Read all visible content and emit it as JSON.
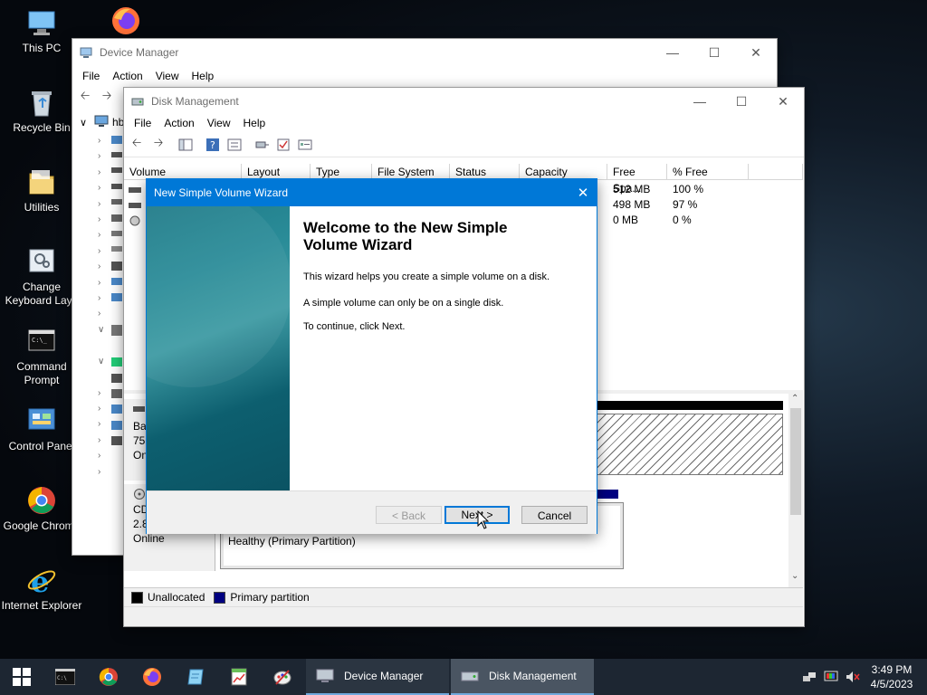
{
  "desktop": {
    "icons": [
      {
        "label": "This PC"
      },
      {
        "label": ""
      },
      {
        "label": "Recycle Bin"
      },
      {
        "label": "Utilities"
      },
      {
        "label": "Change Keyboard Layo"
      },
      {
        "label": "Command Prompt"
      },
      {
        "label": "Control Panel"
      },
      {
        "label": "Google Chrome"
      },
      {
        "label": "Internet Explorer"
      }
    ]
  },
  "device_manager": {
    "title": "Device Manager",
    "menu": [
      "File",
      "Action",
      "View",
      "Help"
    ],
    "tree_root": "hb"
  },
  "disk_management": {
    "title": "Disk Management",
    "menu": [
      "File",
      "Action",
      "View",
      "Help"
    ],
    "columns": [
      "Volume",
      "Layout",
      "Type",
      "File System",
      "Status",
      "Capacity",
      "Free Spa...",
      "% Free"
    ],
    "rows": [
      {
        "free": "512 MB",
        "pct": "100 %"
      },
      {
        "free": "498 MB",
        "pct": "97 %"
      },
      {
        "free": "0 MB",
        "pct": "0 %"
      }
    ],
    "disk0": {
      "line1": "Ba",
      "line2": "75.",
      "line3": "On"
    },
    "cdrom": {
      "line1": "CD",
      "line2": "2.8",
      "line3": "Online",
      "partition_status": "Healthy (Primary Partition)"
    },
    "legend": {
      "unallocated": "Unallocated",
      "primary": "Primary partition",
      "unallocated_color": "#000000",
      "primary_color": "#000080"
    }
  },
  "wizard": {
    "title": "New Simple Volume Wizard",
    "heading": "Welcome to the New Simple Volume Wizard",
    "p1": "This wizard helps you create a simple volume on a disk.",
    "p2": "A simple volume can only be on a single disk.",
    "p3": "To continue, click Next.",
    "back": "< Back",
    "next": "Next >",
    "cancel": "Cancel"
  },
  "taskbar": {
    "tasks": [
      "Device Manager",
      "Disk Management"
    ],
    "time": "3:49 PM",
    "date": "4/5/2023"
  }
}
